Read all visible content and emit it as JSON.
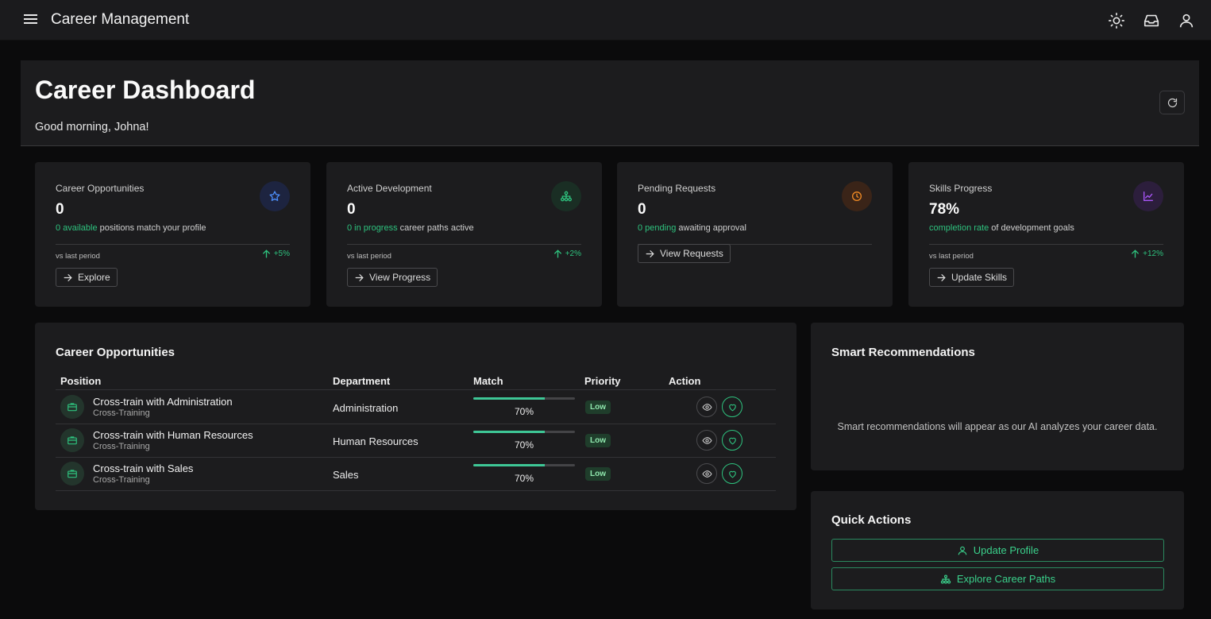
{
  "app": {
    "title": "Career Management"
  },
  "header": {
    "title": "Career Dashboard",
    "greeting": "Good morning, Johna!"
  },
  "stats": [
    {
      "title": "Career Opportunities",
      "value": "0",
      "sub_highlight": "0 available",
      "sub_rest": " positions match your profile",
      "vs": "vs last period",
      "trend": "+5%",
      "button": "Explore",
      "icon": "star-icon",
      "icon_color": "#4d8ef7",
      "icon_bg": "#1d2440"
    },
    {
      "title": "Active Development",
      "value": "0",
      "sub_highlight": "0 in progress",
      "sub_rest": " career paths active",
      "vs": "vs last period",
      "trend": "+2%",
      "button": "View Progress",
      "icon": "sitemap-icon",
      "icon_color": "#2ec27e",
      "icon_bg": "#1a2e24"
    },
    {
      "title": "Pending Requests",
      "value": "0",
      "sub_highlight": "0 pending",
      "sub_rest": " awaiting approval",
      "button": "View Requests",
      "icon": "clock-icon",
      "icon_color": "#f08a24",
      "icon_bg": "#3a2418"
    },
    {
      "title": "Skills Progress",
      "value": "78%",
      "sub_highlight": "completion rate",
      "sub_rest": " of development goals",
      "vs": "vs last period",
      "trend": "+12%",
      "button": "Update Skills",
      "icon": "chart-line-icon",
      "icon_color": "#a855f7",
      "icon_bg": "#2c1e3c"
    }
  ],
  "opportunities": {
    "title": "Career Opportunities",
    "headers": [
      "Position",
      "Department",
      "Match",
      "Priority",
      "Action"
    ],
    "rows": [
      {
        "position": "Cross-train with Administration",
        "type": "Cross-Training",
        "department": "Administration",
        "match": 70,
        "match_label": "70%",
        "priority": "Low"
      },
      {
        "position": "Cross-train with Human Resources",
        "type": "Cross-Training",
        "department": "Human Resources",
        "match": 70,
        "match_label": "70%",
        "priority": "Low"
      },
      {
        "position": "Cross-train with Sales",
        "type": "Cross-Training",
        "department": "Sales",
        "match": 70,
        "match_label": "70%",
        "priority": "Low"
      }
    ]
  },
  "smart": {
    "title": "Smart Recommendations",
    "message": "Smart recommendations will appear as our AI analyzes your career data."
  },
  "quick": {
    "title": "Quick Actions",
    "update_profile": "Update Profile",
    "explore_paths": "Explore Career Paths"
  },
  "colors": {
    "accent": "#2ec27e",
    "background": "#0b0b0c",
    "card": "#1c1c1e"
  }
}
